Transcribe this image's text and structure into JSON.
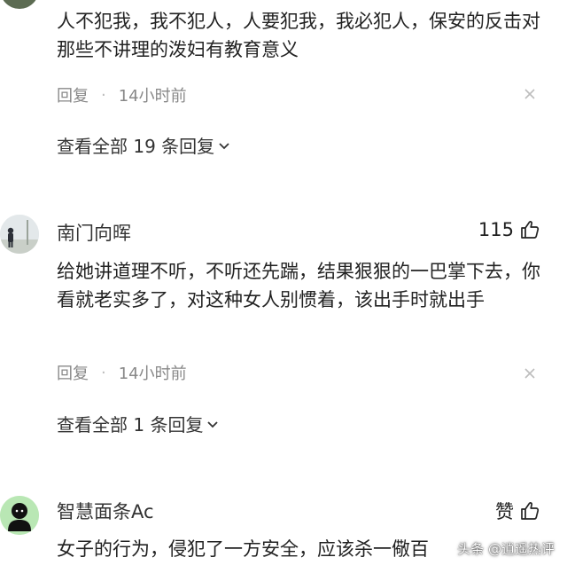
{
  "comments": [
    {
      "text": "人不犯我，我不犯人，人要犯我，我必犯人，保安的反击对那些不讲理的泼妇有教育意义",
      "reply_label": "回复",
      "separator": "·",
      "time": "14小时前",
      "view_replies": "查看全部 19 条回复"
    },
    {
      "username": "南门向晖",
      "likes": "115",
      "text": "给她讲道理不听，不听还先踹，结果狠狠的一巴掌下去，你看就老实多了，对这种女人别惯着，该出手时就出手",
      "reply_label": "回复",
      "separator": "·",
      "time": "14小时前",
      "view_replies": "查看全部 1 条回复"
    },
    {
      "username": "智慧面条Ac",
      "likes": "赞",
      "text": "女子的行为，侵犯了一方安全，应该杀一儆百"
    }
  ],
  "watermark": "头条 @逍遥热评",
  "icons": {
    "like": "thumbs-up-icon",
    "close": "close-icon",
    "chevron": "chevron-down-icon"
  },
  "colors": {
    "muted": "#888888",
    "text": "#222222",
    "avatar_bg": "#b9e7b4"
  }
}
